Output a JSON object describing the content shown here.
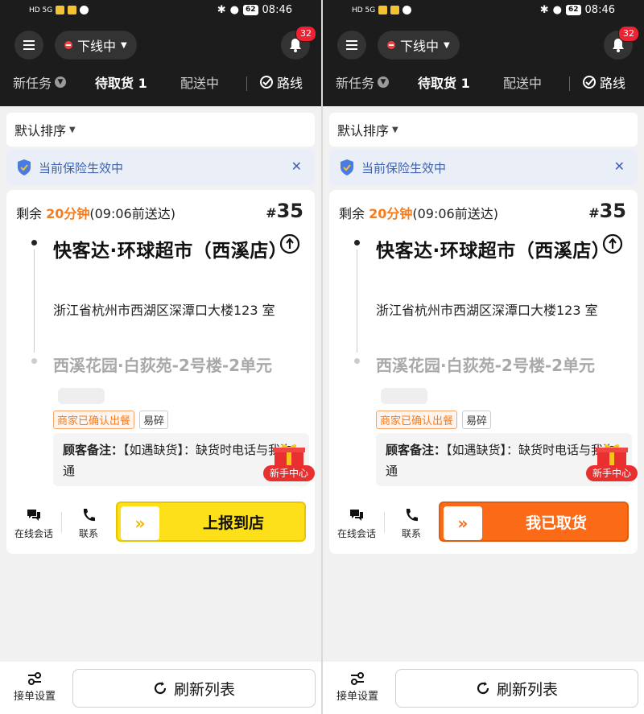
{
  "status_bar": {
    "network": "HD 5G",
    "battery": "62",
    "time": "08:46"
  },
  "header": {
    "status_label": "下线中",
    "notification_count": "32",
    "tabs": [
      {
        "label": "新任务"
      },
      {
        "label": "待取货 1"
      },
      {
        "label": "配送中"
      },
      {
        "label": "路线"
      }
    ]
  },
  "sort": {
    "label": "默认排序"
  },
  "insurance": {
    "text": "当前保险生效中"
  },
  "order": {
    "remain_prefix": "剩余 ",
    "remain_time": "20分钟",
    "deadline": "(09:06前送达)",
    "number_hash": "#",
    "number": "35",
    "shop_name": "快客达·环球超市（西溪店）",
    "shop_address": "浙江省杭州市西湖区深潭口大楼123 室",
    "customer_address": "西溪花园·白荻苑-2号楼-2单元",
    "tags": [
      "商家已确认出餐",
      "易碎"
    ],
    "note_label": "顾客备注：",
    "note_text": "【如遇缺货】：缺货时电话与我沟通",
    "gift_label": "新手中心"
  },
  "actions": {
    "chat": "在线会话",
    "contact": "联系",
    "arrow": "»"
  },
  "panels": {
    "left": {
      "main_button": "上报到店"
    },
    "right": {
      "main_button": "我已取货"
    }
  },
  "footer": {
    "settings": "接单设置",
    "refresh": "刷新列表"
  },
  "colors": {
    "accent_orange": "#f57c1f",
    "button_yellow": "#fde01a",
    "button_orange": "#fa6a17",
    "insurance_blue": "#3d62b0"
  }
}
